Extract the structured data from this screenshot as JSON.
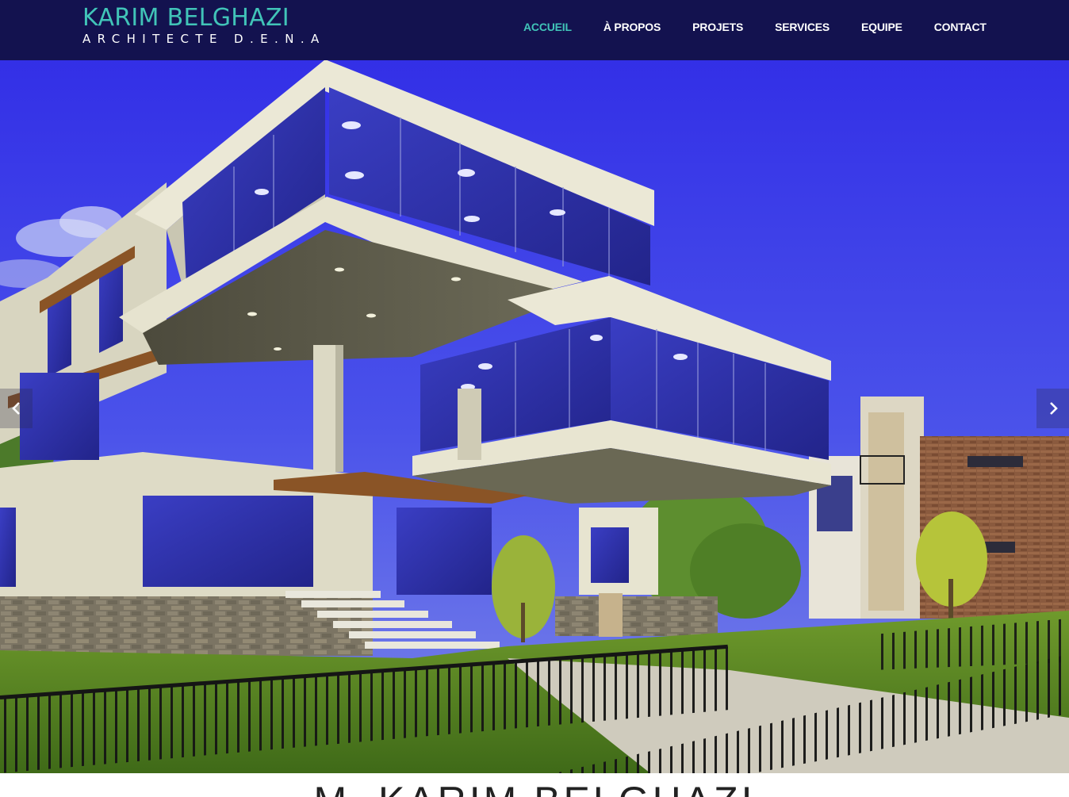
{
  "brand": {
    "name": "KARIM BELGHAZI",
    "tagline": "ARCHITECTE D.E.N.A"
  },
  "nav": {
    "items": [
      {
        "label": "ACCUEIL",
        "active": true
      },
      {
        "label": "À PROPOS",
        "active": false
      },
      {
        "label": "PROJETS",
        "active": false
      },
      {
        "label": "SERVICES",
        "active": false
      },
      {
        "label": "EQUIPE",
        "active": false
      },
      {
        "label": "CONTACT",
        "active": false
      }
    ]
  },
  "carousel": {
    "prev_icon": "chevron-left-icon",
    "next_icon": "chevron-right-icon"
  },
  "intro": {
    "heading": "M. KARIM BELGHAZI"
  },
  "colors": {
    "navbar": "#13124f",
    "accent": "#41c4b8",
    "sky": "#3a3fe0",
    "glass": "#2c2fa8",
    "concrete": "#e9e7d2"
  }
}
